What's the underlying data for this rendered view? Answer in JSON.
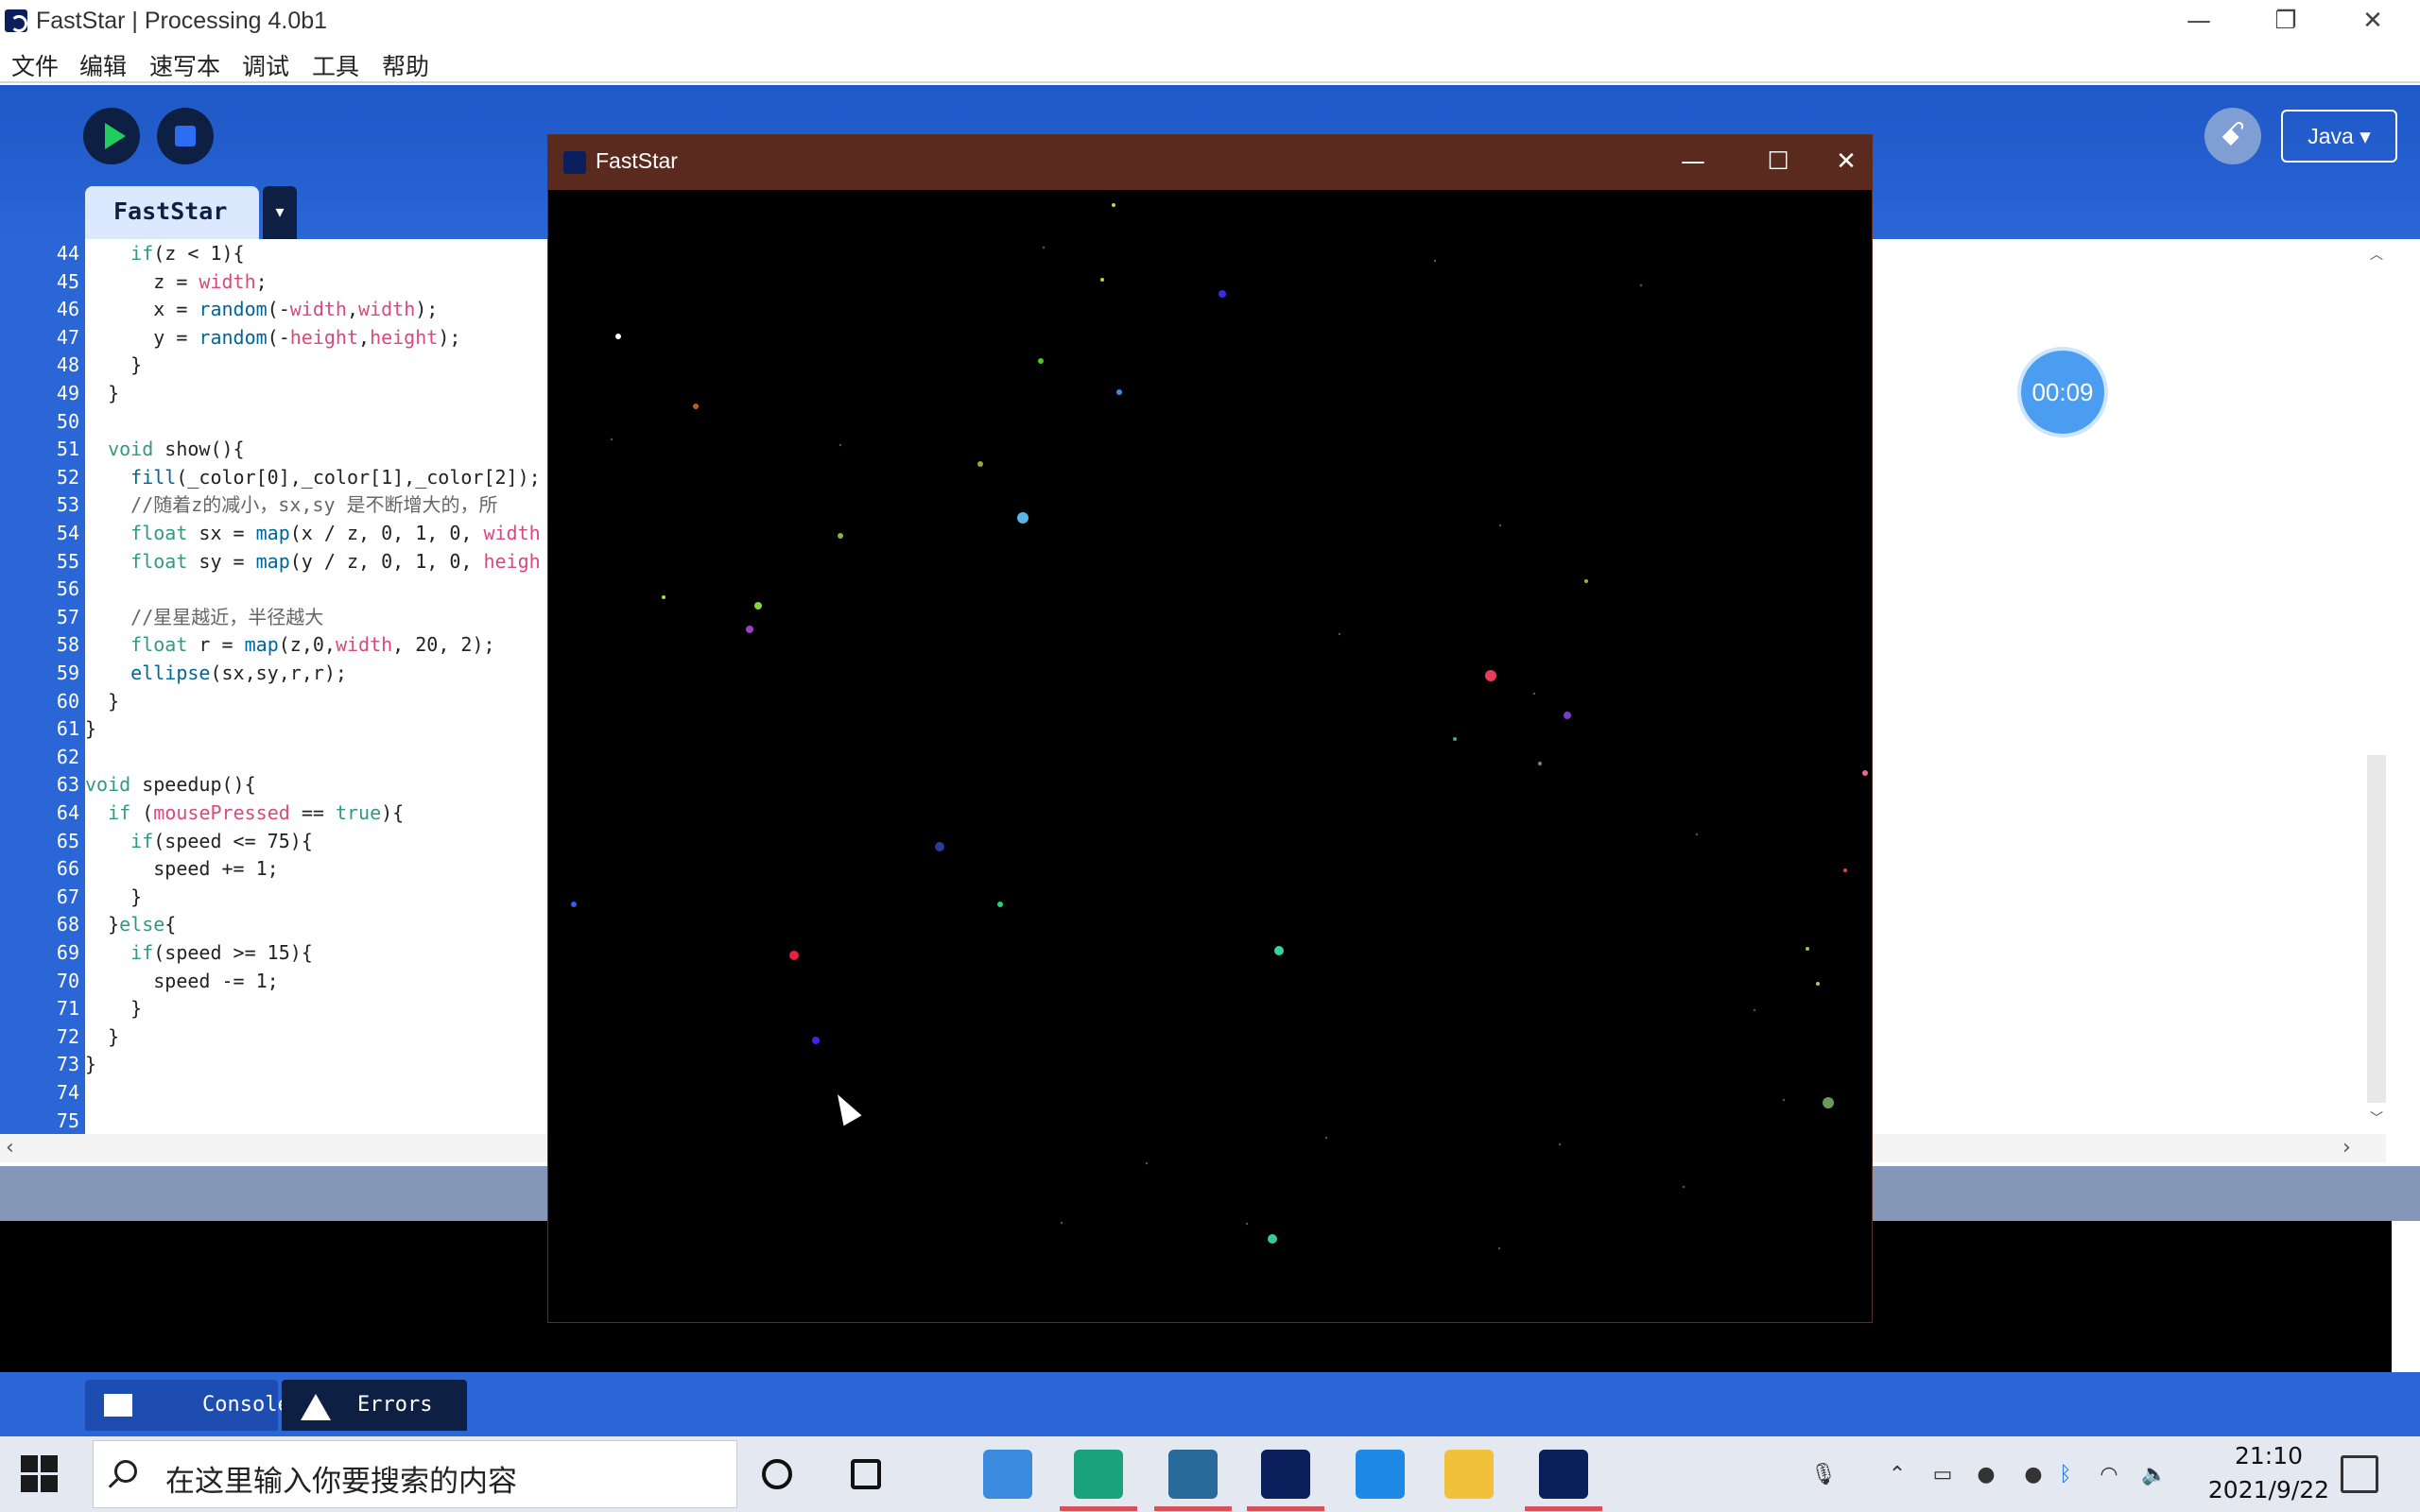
{
  "window": {
    "title": "FastStar | Processing 4.0b1"
  },
  "menu": [
    "文件",
    "编辑",
    "速写本",
    "调试",
    "工具",
    "帮助"
  ],
  "toolbar": {
    "run": "Run",
    "stop": "Stop",
    "debug_glyph": "ꗃ",
    "mode": "Java ▾"
  },
  "tab": {
    "name": "FastStar",
    "menu_glyph": "▾"
  },
  "editor": {
    "line_numbers": [
      "44",
      "45",
      "46",
      "47",
      "48",
      "49",
      "50",
      "51",
      "52",
      "53",
      "54",
      "55",
      "56",
      "57",
      "58",
      "59",
      "60",
      "61",
      "62",
      "63",
      "64",
      "65",
      "66",
      "67",
      "68",
      "69",
      "70",
      "71",
      "72",
      "73",
      "74",
      "75"
    ],
    "lines": [
      "    if(z < 1){",
      "      z = width;",
      "      x = random(-width,width);",
      "      y = random(-height,height);",
      "    }",
      "  }",
      "",
      "  void show(){",
      "    fill(_color[0],_color[1],_color[2]);",
      "    //随着z的减小，sx,sy 是不断增大的，所",
      "    float sx = map(x / z, 0, 1, 0, width",
      "    float sy = map(y / z, 0, 1, 0, heigh",
      "",
      "    //星星越近，半径越大",
      "    float r = map(z,0,width, 20, 2);",
      "    ellipse(sx,sy,r,r);",
      "  }",
      "}",
      "",
      "void speedup(){",
      "  if (mousePressed == true){",
      "    if(speed <= 75){",
      "      speed += 1;",
      "    }",
      "  }else{",
      "    if(speed >= 15){",
      "      speed -= 1;",
      "    }",
      "  }",
      "}",
      "",
      ""
    ]
  },
  "sketch_window": {
    "title": "FastStar",
    "minimize": "—",
    "maximize": "☐",
    "close": "✕",
    "stars": [
      {
        "c": "#c8e63c"
      },
      {
        "c": "#c8d23c"
      },
      {
        "c": "#c8d23c"
      },
      {
        "c": "#3a2ae8"
      },
      {
        "c": "#ffffff"
      },
      {
        "c": "#c85a1e"
      },
      {
        "c": "#3a8ae8"
      },
      {
        "c": "#46c81e"
      },
      {
        "c": "#a0a03c"
      },
      {
        "c": "#5ab4e6"
      },
      {
        "c": "#8ab43c"
      },
      {
        "c": "#a03cc8"
      },
      {
        "c": "#8ad23c"
      },
      {
        "c": "#9ae63c"
      },
      {
        "c": "#e63c5a"
      },
      {
        "c": "#7a3cc8"
      },
      {
        "c": "#46a0a0"
      },
      {
        "c": "#8a7a8a"
      },
      {
        "c": "#e66a8a"
      },
      {
        "c": "#2a3a9a"
      },
      {
        "c": "#28d27a"
      },
      {
        "c": "#3a5ae8"
      },
      {
        "c": "#e6223c"
      },
      {
        "c": "#36d2a0"
      },
      {
        "c": "#3a2ae8"
      },
      {
        "c": "#6a9a5a"
      },
      {
        "c": "#36c8a0"
      },
      {
        "c": "#e64a2a"
      },
      {
        "c": "#8ad23c"
      },
      {
        "c": "#a0c878"
      },
      {
        "c": "#aaaa3c"
      }
    ]
  },
  "timer": "00:09",
  "console_tabs": [
    "Console",
    "Errors"
  ],
  "taskbar": {
    "search_placeholder": "在这里输入你要搜索的内容",
    "clock_time": "21:10",
    "clock_date": "2021/9/22",
    "apps": [
      {
        "name": "cortana-icon",
        "color": "#111111"
      },
      {
        "name": "task-view-icon",
        "color": "#111111"
      },
      {
        "name": "computer-icon",
        "color": "#3a8ae0"
      },
      {
        "name": "edge-icon",
        "color": "#1aa37a"
      },
      {
        "name": "game-icon",
        "color": "#2a6a9a"
      },
      {
        "name": "processing-icon",
        "color": "#0b1f5c"
      },
      {
        "name": "phone-icon",
        "color": "#1e88e5"
      },
      {
        "name": "file-explorer-icon",
        "color": "#f2c13a"
      },
      {
        "name": "processing-active-icon",
        "color": "#0b1f5c"
      }
    ]
  },
  "colors": {
    "header_blue": "#2a66d6",
    "navy": "#0e1f44",
    "run_green": "#1fce5c",
    "sketch_title": "#5a2a1f"
  }
}
